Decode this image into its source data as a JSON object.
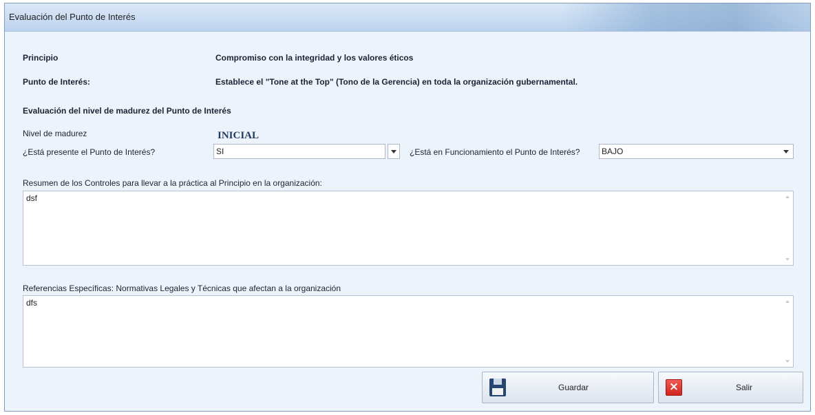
{
  "window": {
    "title": "Evaluación del Punto de Interés"
  },
  "principio": {
    "label": "Principio",
    "value": "Compromiso con la integridad y los valores éticos"
  },
  "punto_interes": {
    "label": "Punto de Interés:",
    "value": "Establece el \"Tone at the Top\" (Tono de la Gerencia) en toda la organización gubernamental."
  },
  "evaluacion": {
    "heading": "Evaluación del nivel de madurez del Punto de Interés",
    "nivel_label": "Nivel de madurez",
    "nivel_value": "INICIAL",
    "presente_label": "¿Está presente el Punto de Interés?",
    "presente_value": "SI",
    "funcionamiento_label": "¿Está en Funcionamiento el Punto de Interés?",
    "funcionamiento_value": "BAJO"
  },
  "resumen": {
    "label": "Resumen de los Controles para llevar a la práctica al Principio en la organización:",
    "value": "dsf"
  },
  "referencias": {
    "label": "Referencias Específicas: Normativas Legales y Técnicas que afectan a la organización",
    "value": "dfs"
  },
  "buttons": {
    "save_label": "Guardar",
    "exit_label": "Salir"
  },
  "icons": {
    "save": "floppy-disk-icon",
    "exit": "red-x-icon"
  }
}
